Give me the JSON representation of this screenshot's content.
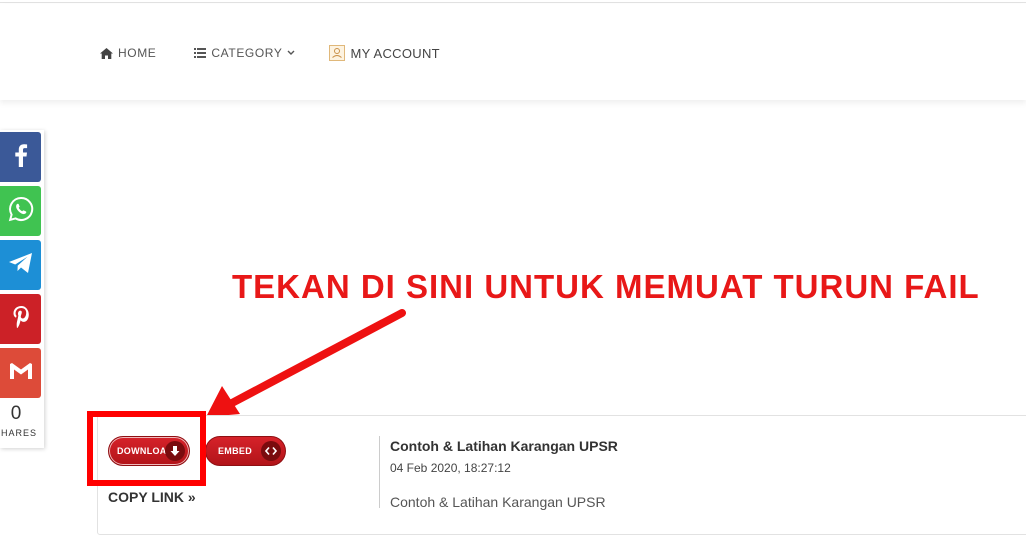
{
  "nav": {
    "home": "HOME",
    "category": "CATEGORY",
    "account": "MY ACCOUNT"
  },
  "share": {
    "count": "0",
    "label": "SHARES",
    "networks": [
      "facebook",
      "whatsapp",
      "telegram",
      "pinterest",
      "gmail"
    ]
  },
  "promo": {
    "text": "TEKAN DI SINI UNTUK MEMUAT TURUN FAIL",
    "color": "#e81818"
  },
  "file": {
    "download_label": "DOWNLOAD",
    "embed_label": "EMBED",
    "copy_link": "COPY LINK »",
    "title": "Contoh & Latihan Karangan UPSR",
    "date": "04 Feb 2020, 18:27:12",
    "description": "Contoh & Latihan Karangan UPSR"
  },
  "colors": {
    "facebook": "#3b5998",
    "whatsapp": "#40c351",
    "telegram": "#1d8fd6",
    "pinterest": "#cc2127",
    "gmail": "#dd4b39",
    "button_red": "#c81b21",
    "highlight": "#ff0000"
  }
}
